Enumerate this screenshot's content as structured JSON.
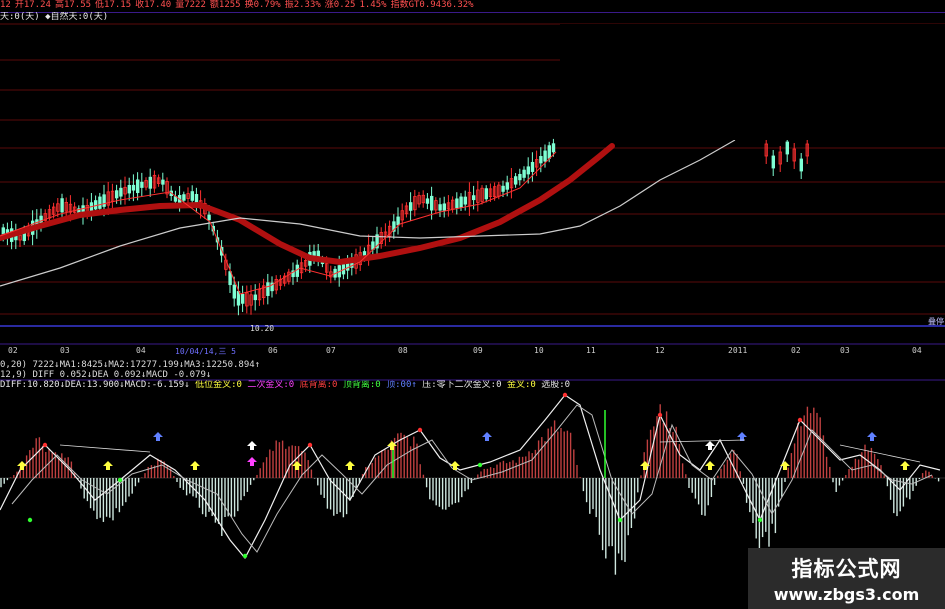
{
  "info_bar": {
    "items": [
      "12",
      "开17.24",
      "高17.55",
      "低17.15",
      "收17.40",
      "量7222",
      "额1255",
      "换0.79%",
      "振2.33%",
      "涨0.25",
      "1.45%",
      "指数GT0.9436.32%"
    ]
  },
  "main_panel": {
    "label": "天:0(天) ◆自然天:0(天)",
    "low_marker": "10.20",
    "side_label": "叠停"
  },
  "time_axis": {
    "labels": [
      "02",
      "03",
      "04",
      "10/04/14,三 5",
      "06",
      "07",
      "08",
      "09",
      "10",
      "11",
      "12",
      "2011",
      "02",
      "03",
      "04"
    ]
  },
  "indicators": {
    "vol_line": "0,20) 7222↓MA1:8425↓MA2:17277.199↓MA3:12250.894↑",
    "macd_line": "12,9) DIFF 0.052↓DEA 0.092↓MACD -0.079↓",
    "custom_line": {
      "diff": "DIFF:10.820↓DEA:13.900↓MACD:-6.159↓",
      "p1": "低位金叉:0",
      "p2": "二次金叉:0",
      "p3": "底背离:0",
      "p4": "顶背离:0",
      "p5": "顶:00↑",
      "p6": "压:零下二次金叉:0",
      "p7": "金叉:0",
      "p8": "选股:0"
    }
  },
  "watermark": {
    "title": "指标公式网",
    "url": "www.zbgs3.com"
  },
  "colors": {
    "background": "#000000",
    "up": "#ff3030",
    "down": "#7fffd4",
    "ma_red": "#b01010",
    "ma_white": "#cccccc",
    "grid_red": "#5a0a0a",
    "separator": "#3a1a8a"
  }
}
